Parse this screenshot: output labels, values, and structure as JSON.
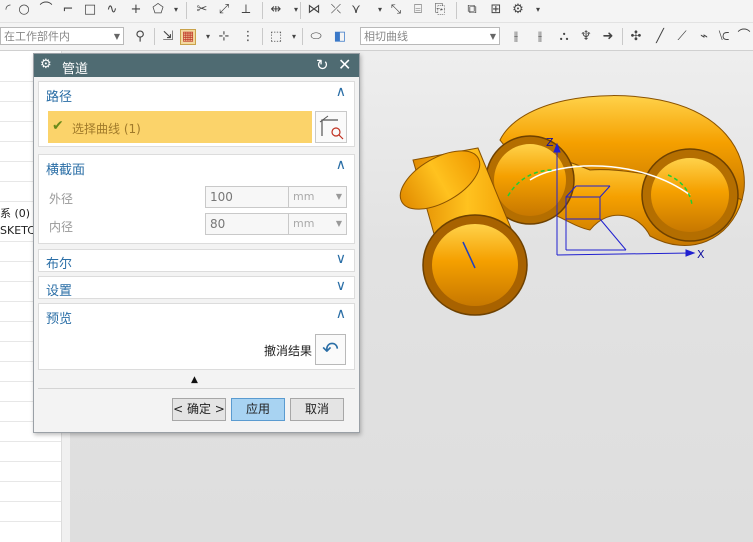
{
  "toolbar_row1": {
    "icons": [
      "arc-icon",
      "circle-icon",
      "fillet-icon",
      "curve-icon",
      "rectangle-icon",
      "spline-icon",
      "point-icon",
      "polygon-icon",
      "trim-icon",
      "extend-icon",
      "corner-icon",
      "mirror-icon",
      "offset-icon",
      "pattern-icon",
      "derive-icon",
      "project-icon",
      "intersect-icon",
      "copy-icon",
      "layer-icon",
      "constraint-icon"
    ]
  },
  "toolbar_row2": {
    "scope_combo": "在工作部件内",
    "snap_combo": "相切曲线"
  },
  "navigator": {
    "item_a": "系 (0)",
    "item_b": "SKETC"
  },
  "dialog": {
    "title": "管道",
    "path_section": {
      "header": "路径",
      "select_label": "选择曲线 (1)"
    },
    "cross_section": {
      "header": "横截面",
      "outer_label": "外径",
      "outer_value": "100",
      "outer_unit": "mm",
      "inner_label": "内径",
      "inner_value": "80",
      "inner_unit": "mm"
    },
    "boolean_section": {
      "header": "布尔"
    },
    "settings_section": {
      "header": "设置"
    },
    "preview_section": {
      "header": "预览",
      "undo_label": "撤消结果"
    },
    "buttons": {
      "ok": "< 确定 >",
      "apply": "应用",
      "cancel": "取消"
    }
  },
  "viewport": {
    "axis_z": "Z",
    "axis_x": "X"
  },
  "colors": {
    "pipe_orange": "#f5a000",
    "pipe_edge": "#8a5200",
    "title_bar": "#4f6b72",
    "selected_row": "#fbd36a",
    "apply_button": "#a8d3f2",
    "section_header": "#2a6ea6"
  }
}
